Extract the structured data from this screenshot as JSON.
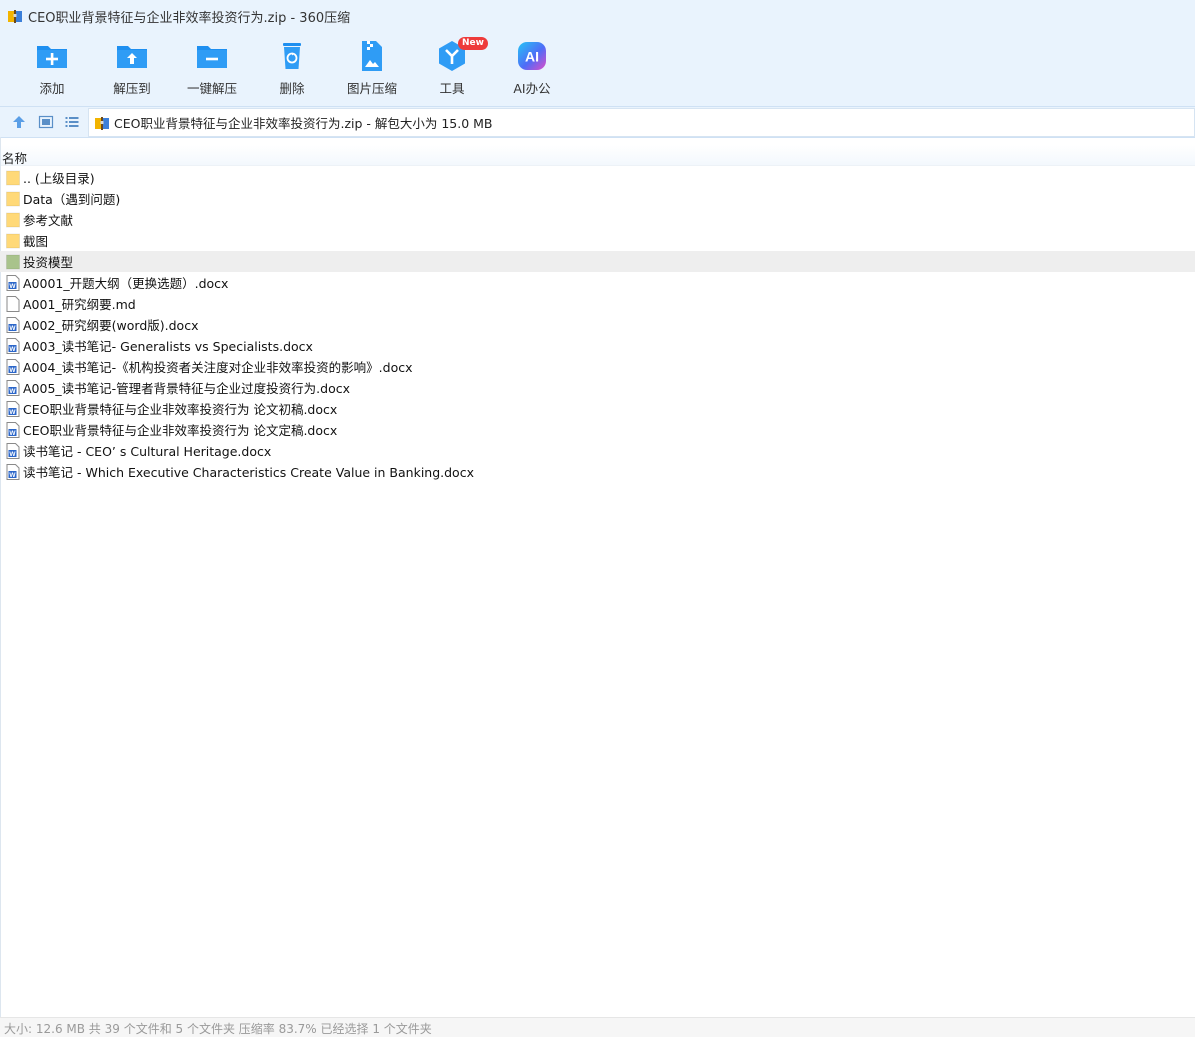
{
  "window": {
    "title": "CEO职业背景特征与企业非效率投资行为.zip - 360压缩"
  },
  "toolbar": {
    "items": [
      {
        "label": "添加",
        "icon": "add-folder-icon"
      },
      {
        "label": "解压到",
        "icon": "extract-to-icon"
      },
      {
        "label": "一键解压",
        "icon": "one-click-extract-icon"
      },
      {
        "label": "删除",
        "icon": "recycle-bin-icon"
      },
      {
        "label": "图片压缩",
        "icon": "image-compress-icon"
      },
      {
        "label": "工具",
        "icon": "tools-icon",
        "badge": "New"
      },
      {
        "label": "AI办公",
        "icon": "ai-office-icon",
        "icon_text": "AI"
      }
    ]
  },
  "nav": {
    "path": "CEO职业背景特征与企业非效率投资行为.zip - 解包大小为 15.0 MB"
  },
  "columns": {
    "name": "名称"
  },
  "files": [
    {
      "name": ".. (上级目录)",
      "type": "folder"
    },
    {
      "name": "Data（遇到问题)",
      "type": "folder"
    },
    {
      "name": "参考文献",
      "type": "folder"
    },
    {
      "name": "截图",
      "type": "folder"
    },
    {
      "name": "投资模型",
      "type": "folder",
      "selected": true
    },
    {
      "name": "A0001_开题大纲（更换选题）.docx",
      "type": "docx"
    },
    {
      "name": "A001_研究纲要.md",
      "type": "file"
    },
    {
      "name": "A002_研究纲要(word版).docx",
      "type": "docx"
    },
    {
      "name": "A003_读书笔记- Generalists vs Specialists.docx",
      "type": "docx"
    },
    {
      "name": "A004_读书笔记-《机构投资者关注度对企业非效率投资的影响》.docx",
      "type": "docx"
    },
    {
      "name": "A005_读书笔记-管理者背景特征与企业过度投资行为.docx",
      "type": "docx"
    },
    {
      "name": "CEO职业背景特征与企业非效率投资行为 论文初稿.docx",
      "type": "docx"
    },
    {
      "name": "CEO职业背景特征与企业非效率投资行为 论文定稿.docx",
      "type": "docx"
    },
    {
      "name": "读书笔记 - CEO’ s Cultural Heritage.docx",
      "type": "docx"
    },
    {
      "name": "读书笔记 - Which Executive Characteristics Create Value in Banking.docx",
      "type": "docx"
    }
  ],
  "status": {
    "text": "大小: 12.6 MB 共 39 个文件和 5 个文件夹 压缩率 83.7% 已经选择 1 个文件夹"
  },
  "colors": {
    "accent": "#1e8ff0",
    "chrome": "#e9f3fd",
    "folder": "#ffd978",
    "selected_folder": "#a9c38c",
    "badge": "#ee3b3b"
  }
}
